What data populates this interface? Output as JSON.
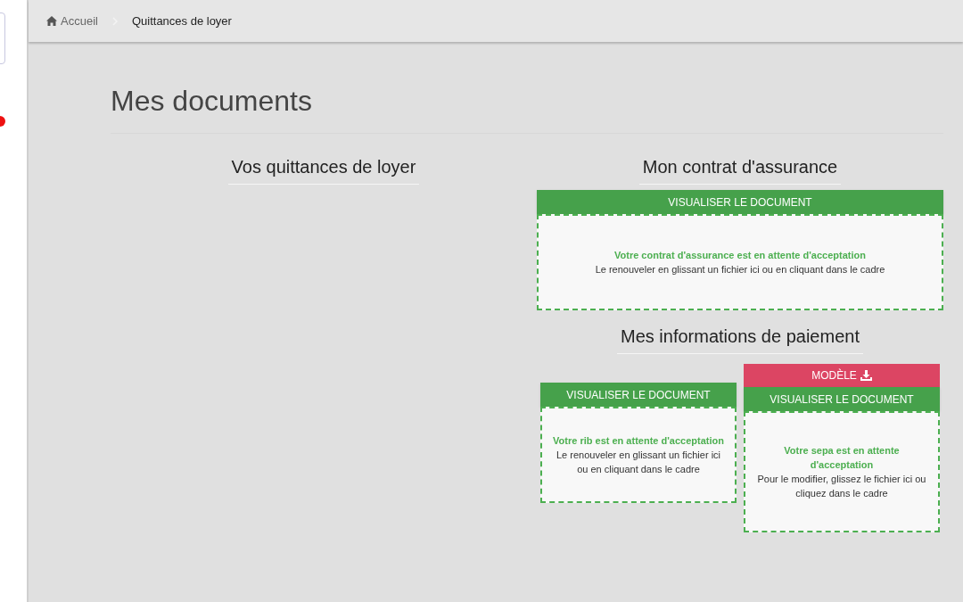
{
  "breadcrumb": [
    {
      "label": "Accueil",
      "kind": "home"
    },
    {
      "label": "Quittances de loyer",
      "kind": "current"
    }
  ],
  "page_title": "Mes documents",
  "sections": {
    "rent_receipts": {
      "title": "Vos quittances de loyer"
    },
    "insurance": {
      "title": "Mon contrat d'assurance",
      "view_button": "VISUALISER LE DOCUMENT",
      "status": "Votre contrat d'assurance est en attente d'acceptation",
      "hint": "Le renouveler en glissant un fichier ici ou en cliquant dans le cadre"
    },
    "payment": {
      "title": "Mes informations de paiement",
      "cards": [
        {
          "view_button": "VISUALISER LE DOCUMENT",
          "status": "Votre rib est en attente d'acceptation",
          "hint": "Le renouveler en glissant un fichier ici ou en cliquant dans le cadre"
        },
        {
          "template_button": "MODÈLE",
          "view_button": "VISUALISER LE DOCUMENT",
          "status": "Votre sepa est en attente d'acceptation",
          "hint": "Pour le modifier, glissez le fichier ici ou cliquez dans le cadre"
        }
      ]
    }
  }
}
